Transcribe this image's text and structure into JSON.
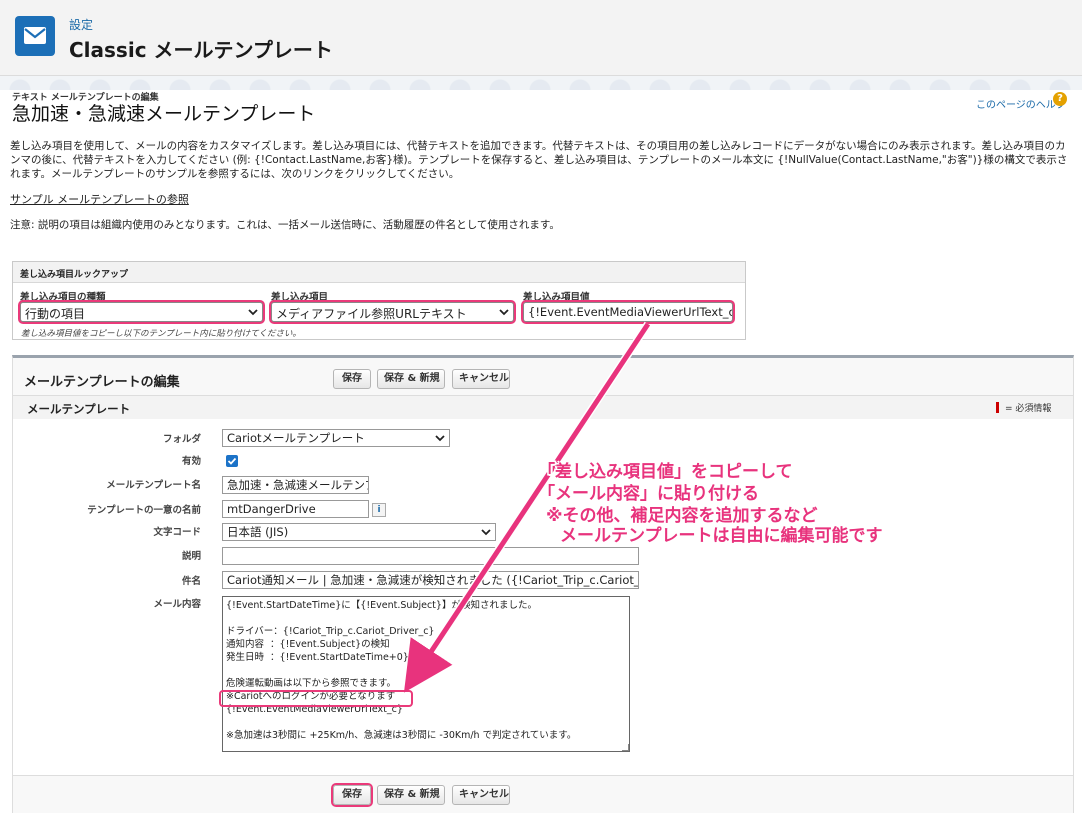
{
  "header": {
    "breadcrumb": "設定",
    "title": "Classic メールテンプレート",
    "icon": "email-icon",
    "icon_color": "#1c6fb7"
  },
  "page": {
    "subtitle": "テキスト メールテンプレートの編集",
    "title": "急加速・急減速メールテンプレート",
    "help_link": "このページのヘルプ",
    "description": "差し込み項目を使用して、メールの内容をカスタマイズします。差し込み項目には、代替テキストを追加できます。代替テキストは、その項目用の差し込みレコードにデータがない場合にのみ表示されます。差し込み項目のカンマの後に、代替テキストを入力してください (例: {!Contact.LastName,お客}様)。テンプレートを保存すると、差し込み項目は、テンプレートのメール本文に {!NullValue(Contact.LastName,\"お客\")}様の構文で表示されます。メールテンプレートのサンプルを参照するには、次のリンクをクリックしてください。",
    "sample_link": "サンプル メールテンプレートの参照",
    "note": "注意: 説明の項目は組織内使用のみとなります。これは、一括メール送信時に、活動履歴の件名として使用されます。"
  },
  "lookup": {
    "title": "差し込み項目ルックアップ",
    "type_label": "差し込み項目の種類",
    "type_value": "行動の項目",
    "field_label": "差し込み項目",
    "field_value": "メディアファイル参照URLテキスト",
    "value_label": "差し込み項目値",
    "value_value": "{!Event.EventMediaViewerUrlText_c}",
    "help": "差し込み項目値をコピーし以下のテンプレート内に貼り付けてください。"
  },
  "edit": {
    "title": "メールテンプレートの編集",
    "save": "保存",
    "save_new": "保存 & 新規",
    "cancel": "キャンセル",
    "section_title": "メールテンプレート",
    "required_legend": "= 必須情報"
  },
  "form": {
    "folder_label": "フォルダ",
    "folder_value": "Cariotメールテンプレート",
    "active_label": "有効",
    "active_checked": true,
    "name_label": "メールテンプレート名",
    "name_value": "急加速・急減速メールテンプレート",
    "unique_label": "テンプレートの一意の名前",
    "unique_value": "mtDangerDrive",
    "encoding_label": "文字コード",
    "encoding_value": "日本語 (JIS)",
    "desc_label": "説明",
    "desc_value": "",
    "subject_label": "件名",
    "subject_value": "Cariot通知メール | 急加速・急減速が検知されました ({!Cariot_Trip_c.Cariot_",
    "body_label": "メール内容",
    "body_value": "{!Event.StartDateTime}に【{!Event.Subject}】が検知されました。\n\nドライバー：{!Cariot_Trip_c.Cariot_Driver_c}\n通知内容  ：{!Event.Subject}の検知\n発生日時  ：{!Event.StartDateTime+0}\n\n危険運転動画は以下から参照できます。\n※Cariotへのログインが必要となります\n{!Event.EventMediaViewerUrlText_c}\n\n※急加速は3秒間に +25Km/h、急減速は3秒間に -30Km/h で判定されています。"
  },
  "annotation": {
    "line1": "「差し込み項目値」をコピーして",
    "line2": "「メール内容」に貼り付ける",
    "line3": "※その他、補足内容を追加するなど",
    "line4": "メールテンプレートは自由に編集可能です",
    "color": "#e8337d"
  }
}
